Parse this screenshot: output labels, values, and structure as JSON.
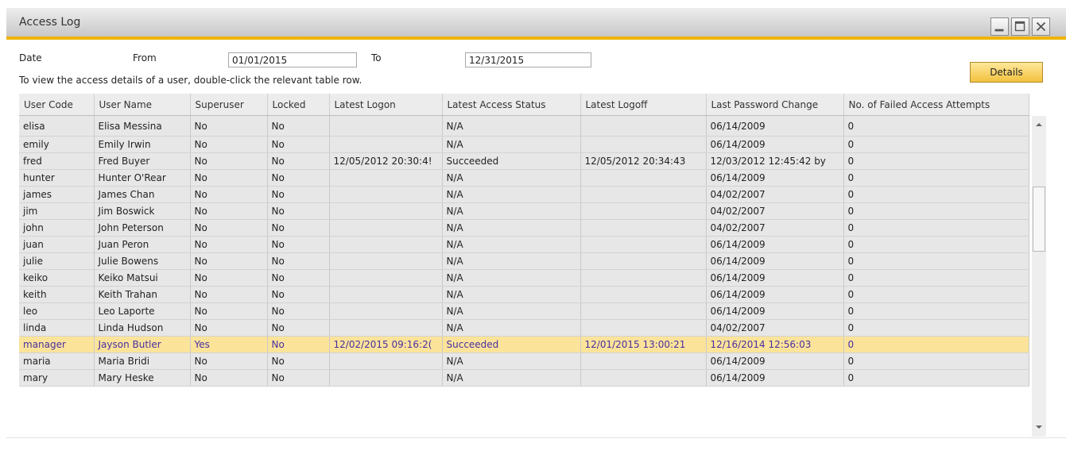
{
  "window": {
    "title": "Access Log"
  },
  "filter": {
    "date_label": "Date",
    "from_label": "From",
    "from_value": "01/01/2015",
    "to_label": "To",
    "to_value": "12/31/2015",
    "hint": "To view the access details of a user, double-click the relevant table row."
  },
  "details_button": "Details",
  "colors": {
    "accent": "#f0b400",
    "selected_row": "#fbe39a",
    "selected_text": "#4a2fa0"
  },
  "table": {
    "columns": [
      "User Code",
      "User Name",
      "Superuser",
      "Locked",
      "Latest Logon",
      "Latest Access Status",
      "Latest Logoff",
      "Last Password Change",
      "No. of Failed Access Attempts"
    ],
    "rows": [
      [
        "elisa",
        "Elisa Messina",
        "No",
        "No",
        "",
        "N/A",
        "",
        "06/14/2009",
        "0"
      ],
      [
        "emily",
        "Emily Irwin",
        "No",
        "No",
        "",
        "N/A",
        "",
        "06/14/2009",
        "0"
      ],
      [
        "fred",
        "Fred Buyer",
        "No",
        "No",
        "12/05/2012 20:30:4!",
        "Succeeded",
        "12/05/2012 20:34:43",
        "12/03/2012 12:45:42 by",
        "0"
      ],
      [
        "hunter",
        "Hunter O'Rear",
        "No",
        "No",
        "",
        "N/A",
        "",
        "06/14/2009",
        "0"
      ],
      [
        "james",
        "James Chan",
        "No",
        "No",
        "",
        "N/A",
        "",
        "04/02/2007",
        "0"
      ],
      [
        "jim",
        "Jim Boswick",
        "No",
        "No",
        "",
        "N/A",
        "",
        "04/02/2007",
        "0"
      ],
      [
        "john",
        "John Peterson",
        "No",
        "No",
        "",
        "N/A",
        "",
        "04/02/2007",
        "0"
      ],
      [
        "juan",
        "Juan Peron",
        "No",
        "No",
        "",
        "N/A",
        "",
        "06/14/2009",
        "0"
      ],
      [
        "julie",
        "Julie Bowens",
        "No",
        "No",
        "",
        "N/A",
        "",
        "06/14/2009",
        "0"
      ],
      [
        "keiko",
        "Keiko Matsui",
        "No",
        "No",
        "",
        "N/A",
        "",
        "06/14/2009",
        "0"
      ],
      [
        "keith",
        "Keith Trahan",
        "No",
        "No",
        "",
        "N/A",
        "",
        "06/14/2009",
        "0"
      ],
      [
        "leo",
        "Leo Laporte",
        "No",
        "No",
        "",
        "N/A",
        "",
        "06/14/2009",
        "0"
      ],
      [
        "linda",
        "Linda Hudson",
        "No",
        "No",
        "",
        "N/A",
        "",
        "04/02/2007",
        "0"
      ],
      [
        "manager",
        "Jayson Butler",
        "Yes",
        "No",
        "12/02/2015 09:16:2(",
        "Succeeded",
        "12/01/2015 13:00:21",
        "12/16/2014 12:56:03",
        "0"
      ],
      [
        "maria",
        "Maria Bridi",
        "No",
        "No",
        "",
        "N/A",
        "",
        "06/14/2009",
        "0"
      ],
      [
        "mary",
        "Mary Heske",
        "No",
        "No",
        "",
        "N/A",
        "",
        "06/14/2009",
        "0"
      ]
    ],
    "selected_row": 13
  },
  "icons": {
    "minimize": "minimize-icon",
    "maximize": "maximize-icon",
    "close": "close-icon",
    "scroll_up": "scroll-up-arrow-icon",
    "scroll_down": "scroll-down-arrow-icon"
  }
}
